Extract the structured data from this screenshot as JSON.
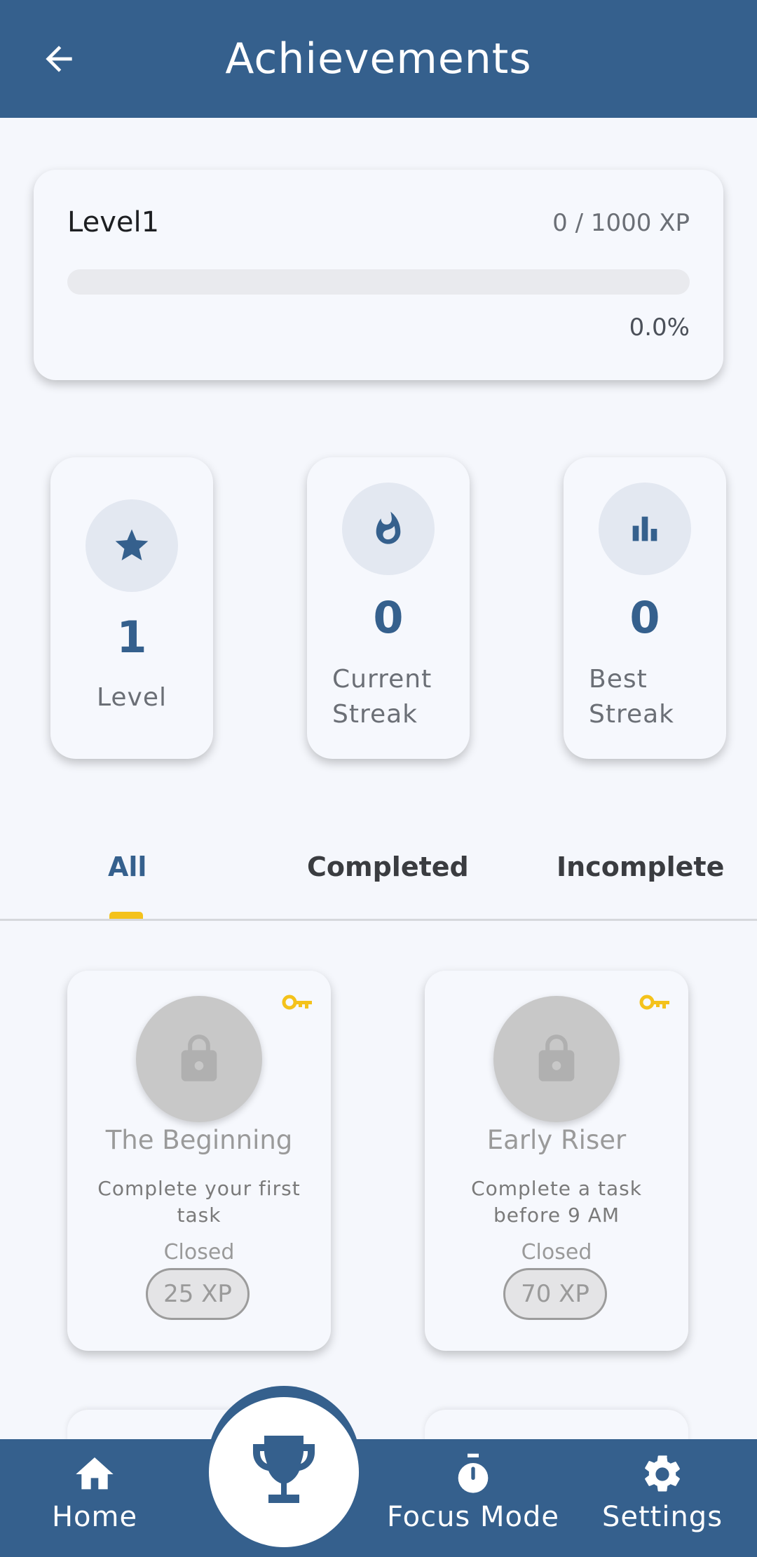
{
  "appbar": {
    "title": "Achievements",
    "back_icon": "arrow-left-icon"
  },
  "level_card": {
    "level_name": "Level1",
    "xp_text": "0 / 1000 XP",
    "progress_fraction": 0.0,
    "percent_text": "0.0%"
  },
  "stats": [
    {
      "icon": "star-icon",
      "value": "1",
      "label": "Level"
    },
    {
      "icon": "flame-icon",
      "value": "0",
      "label_line1": "Current",
      "label_line2": "Streak"
    },
    {
      "icon": "bar-chart-icon",
      "value": "0",
      "label_line1": "Best",
      "label_line2": "Streak"
    }
  ],
  "tabs": {
    "all": "All",
    "completed": "Completed",
    "incomplete": "Incomplete",
    "active": "All"
  },
  "achievements": [
    {
      "title": "The Beginning",
      "description": "Complete your first task",
      "status": "Closed",
      "xp": "25 XP",
      "icon": "lock-icon",
      "badge_icon": "key-icon"
    },
    {
      "title": "Early Riser",
      "description": "Complete a task before 9 AM",
      "status": "Closed",
      "xp": "70 XP",
      "icon": "lock-icon",
      "badge_icon": "key-icon"
    }
  ],
  "bottom_nav": {
    "home": "Home",
    "focus": "Focus Mode",
    "settings": "Settings"
  },
  "colors": {
    "primary": "#35608d",
    "accent": "#f4c21b",
    "background": "#f5f7fc"
  }
}
